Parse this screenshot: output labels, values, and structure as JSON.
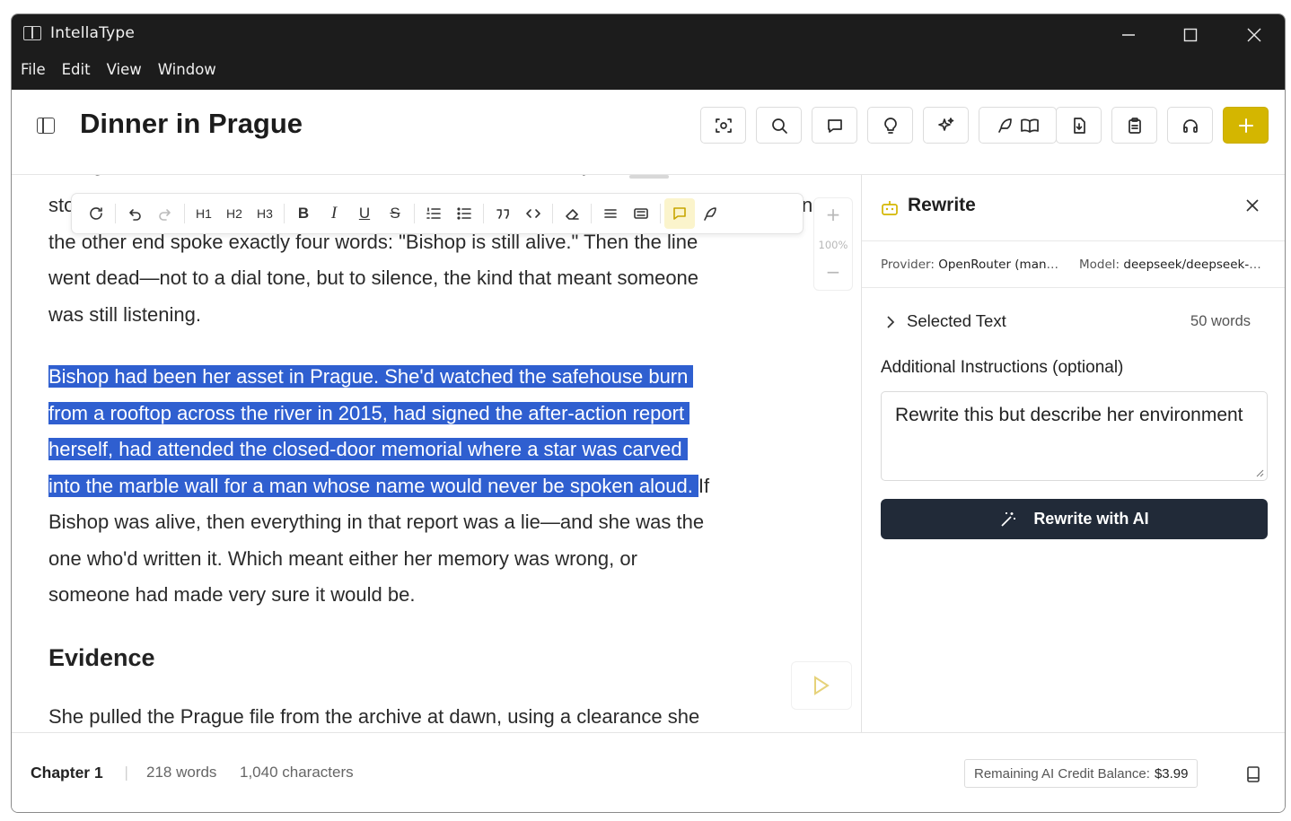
{
  "app": {
    "title": "IntellaType"
  },
  "menu": [
    "File",
    "Edit",
    "View",
    "Window"
  ],
  "document": {
    "title": "Dinner in Prague"
  },
  "toolbar_icons": [
    "focus-icon",
    "search-icon",
    "comment-icon",
    "idea-icon",
    "sparkles-icon",
    "write-read-icon",
    "export-icon",
    "clipboard-icon",
    "headphones-icon",
    "plus-icon"
  ],
  "format_toolbar": {
    "h1": "H1",
    "h2": "H2",
    "h3": "H3",
    "bold": "B",
    "italic": "I",
    "underline": "U",
    "strike": "S"
  },
  "editor": {
    "cut_top_line": "strange, because that line had been disconnected for eleven years. She",
    "para1": [
      "sto",
      "the other end spoke exactly four words: \"Bishop is still alive.\" Then the line",
      "went dead—not to a dial tone, but to silence, the kind that meant someone",
      "was still listening."
    ],
    "para1_tail": "n",
    "selected": [
      "Bishop had been her asset in Prague. She'd watched the safehouse burn",
      "from a rooftop across the river in 2015, had signed the after-action report",
      "herself, had attended the closed-door memorial where a star was carved",
      "into the marble wall for a man whose name would never be spoken aloud."
    ],
    "after_selection": "If",
    "para2_rest": [
      "Bishop was alive, then everything in that report was a lie—and she was the",
      "one who'd written it. Which meant either her memory was wrong, or",
      "someone had made very sure it would be."
    ],
    "heading": "Evidence",
    "para3": "She pulled the Prague file from the archive at dawn, using a clearance she",
    "zoom": {
      "plus": "+",
      "value": "100%",
      "minus": "−"
    }
  },
  "rewrite_panel": {
    "title": "Rewrite",
    "provider_label": "Provider:",
    "provider_value": "OpenRouter (managed)",
    "model_label": "Model:",
    "model_value": "deepseek/deepseek-chat",
    "selected_text_label": "Selected Text",
    "selected_text_count": "50 words",
    "instructions_label": "Additional Instructions (optional)",
    "instructions_value": "Rewrite this but describe her environment",
    "button_label": "Rewrite with AI"
  },
  "status": {
    "chapter": "Chapter 1",
    "separator": "|",
    "words": "218 words",
    "characters": "1,040 characters",
    "credit_label": "Remaining AI Credit Balance:",
    "credit_value": "$3.99"
  },
  "colors": {
    "accent": "#d4b600",
    "selection": "#2f5fd0",
    "primary_button": "#212a38",
    "titlebar": "#1c1c1c"
  }
}
